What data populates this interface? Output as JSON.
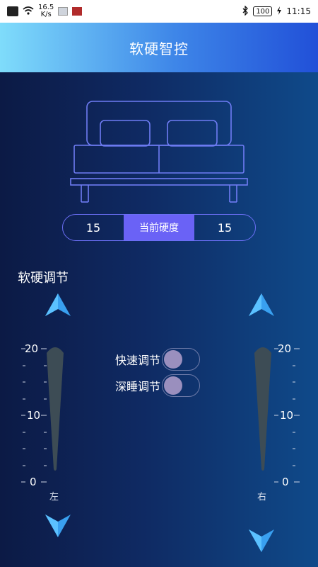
{
  "statusbar": {
    "speed": "16.5",
    "speed_unit": "K/s",
    "battery": "100",
    "time": "11:15"
  },
  "appbar": {
    "title": "软硬智控"
  },
  "hardness": {
    "left_value": "15",
    "label": "当前硬度",
    "right_value": "15"
  },
  "section_title": "软硬调节",
  "left_scale": {
    "ticks": [
      "20",
      "10",
      "0"
    ],
    "label": "左"
  },
  "right_scale": {
    "ticks": [
      "20",
      "10",
      "0"
    ],
    "label": "右"
  },
  "toggles": [
    {
      "label": "快速调节",
      "on": false
    },
    {
      "label": "深睡调节",
      "on": false
    }
  ],
  "colors": {
    "accent": "#6a62f6",
    "arrow": "#39a0f0",
    "appbar_left": "#7fdcfb",
    "appbar_right": "#2150d8"
  }
}
